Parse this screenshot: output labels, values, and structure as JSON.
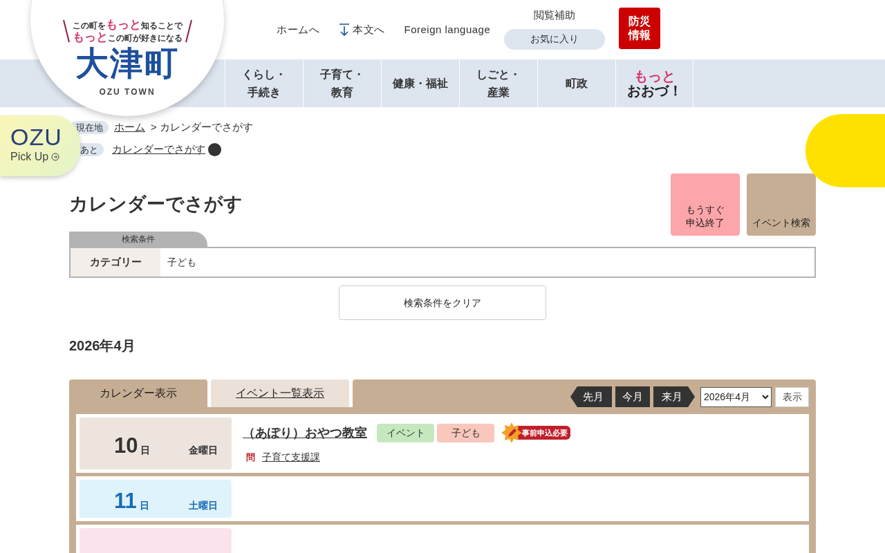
{
  "logo": {
    "tagline_1": "この町を",
    "tagline_2": "もっと",
    "tagline_3": "知ることで",
    "tagline_4": "もっと",
    "tagline_5": "この町が好きになる",
    "name": "大津町",
    "subtitle": "OZU TOWN"
  },
  "header_links": [
    {
      "label": "ホームへ",
      "kind": "plain"
    },
    {
      "label": "本文へ",
      "kind": "down"
    },
    {
      "label": "Foreign language",
      "kind": "plain"
    }
  ],
  "assist": {
    "title": "閲覧補助",
    "favorite": "お気に入り"
  },
  "disaster_button": [
    "防災",
    "情報"
  ],
  "nav": [
    {
      "lines": [
        "くらし・",
        "手続き"
      ]
    },
    {
      "lines": [
        "子育て・",
        "教育"
      ]
    },
    {
      "lines": [
        "健康・福祉"
      ]
    },
    {
      "lines": [
        "しごと・",
        "産業"
      ]
    },
    {
      "lines": [
        "町政"
      ]
    }
  ],
  "nav_special": {
    "line_1": "もっと",
    "line_2": "おおづ！"
  },
  "pickup": {
    "title": "OZU",
    "subtitle": "Pick Up"
  },
  "breadcrumb": {
    "label": "現在地",
    "home": "ホーム",
    "separator": ">",
    "current": "カレンダーでさがす"
  },
  "history": {
    "label": "あと",
    "link": "カレンダーでさがす"
  },
  "page_title": "カレンダーでさがす",
  "side_buttons": [
    {
      "lines": [
        "もうすぐ",
        "申込終了"
      ],
      "color": "#fca6aa"
    },
    {
      "lines": [
        "イベント検索"
      ],
      "color": "#c6ae94"
    }
  ],
  "conditions": {
    "tab": "検索条件",
    "rows": [
      {
        "label": "カテゴリー",
        "value": "子ども"
      }
    ],
    "clear_button": "検索条件をクリア"
  },
  "month_heading": "2026年4月",
  "view_tabs": [
    {
      "label": "カレンダー表示",
      "selected": true
    },
    {
      "label": "イベント一覧表示",
      "selected": false
    }
  ],
  "month_nav": {
    "prev": "先月",
    "current": "今月",
    "next": "来月",
    "select_value": "2026年4月",
    "show_button": "表示"
  },
  "days": [
    {
      "kind": "weekday",
      "day": "10",
      "unit": "日",
      "weekday": "金曜日",
      "events": [
        {
          "title": "（あぽり）おやつ教室",
          "tags": [
            {
              "label": "イベント",
              "color": "#c5e8bf"
            },
            {
              "label": "子ども",
              "color": "#f9c7bb"
            }
          ],
          "badge": "事前申込必要",
          "contact_mark": "問",
          "contact": "子育て支援課"
        }
      ]
    },
    {
      "kind": "saturday",
      "day": "11",
      "unit": "日",
      "weekday": "土曜日"
    },
    {
      "kind": "sunday"
    }
  ]
}
